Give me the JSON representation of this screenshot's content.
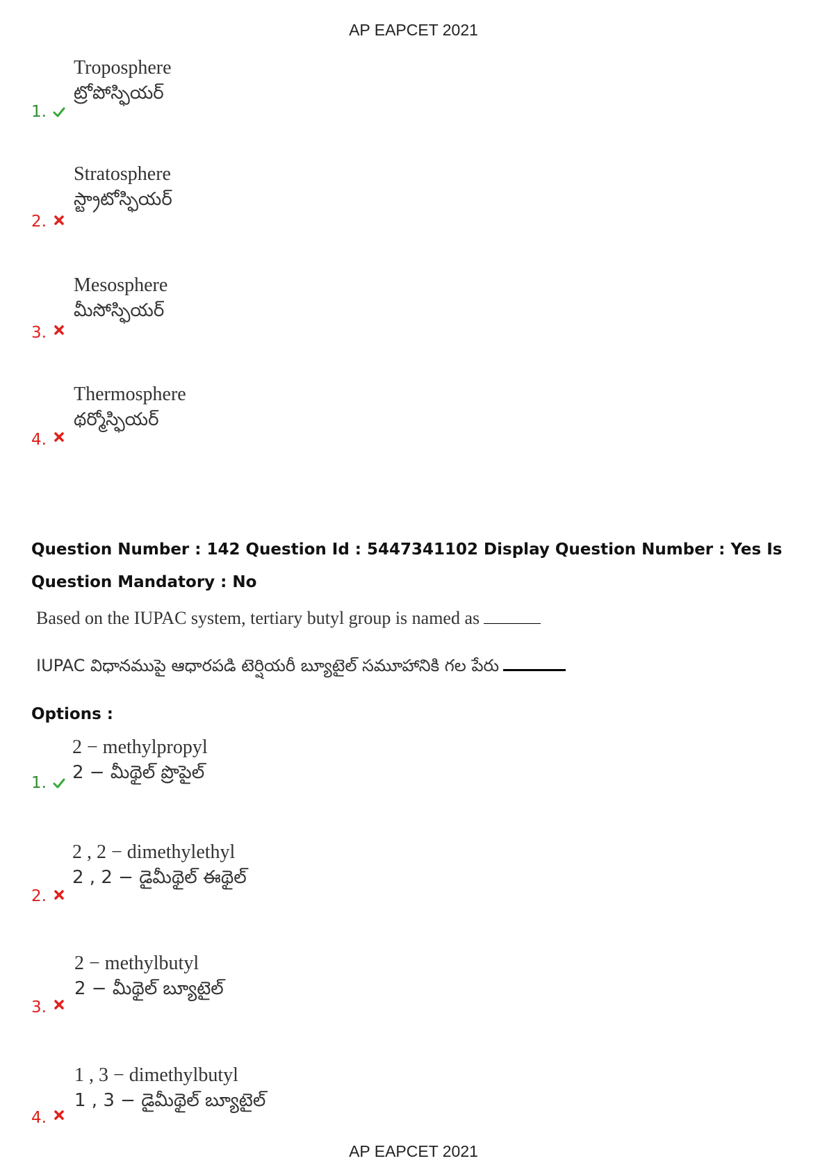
{
  "header": {
    "title": "AP EAPCET 2021"
  },
  "footer": {
    "title": "AP EAPCET 2021"
  },
  "prev_options": [
    {
      "number": "1.",
      "status": "correct",
      "en": "Troposphere",
      "te": "ట్రోపోస్ఫియర్"
    },
    {
      "number": "2.",
      "status": "wrong",
      "en": "Stratosphere",
      "te": "స్ట్రాటోస్ఫియర్"
    },
    {
      "number": "3.",
      "status": "wrong",
      "en": "Mesosphere",
      "te": "మీసోస్ఫియర్"
    },
    {
      "number": "4.",
      "status": "wrong",
      "en": "Thermosphere",
      "te": "థర్మోస్ఫియర్"
    }
  ],
  "question": {
    "meta": "Question Number : 142 Question Id : 5447341102 Display Question Number : Yes Is Question Mandatory : No",
    "text_en": "Based on the IUPAC system, tertiary butyl group is named as",
    "text_te": "IUPAC విధానముపై ఆధారపడి టెర్షియరీ బ్యూటైల్ సమూహానికి గల పేరు",
    "options_label": "Options :",
    "options": [
      {
        "number": "1.",
        "status": "correct",
        "en": "2 − methylpropyl",
        "te": "2 − మీథైల్ ప్రొపైల్"
      },
      {
        "number": "2.",
        "status": "wrong",
        "en": "2 , 2 − dimethylethyl",
        "te": "2 , 2 − డైమీథైల్ ఈథైల్"
      },
      {
        "number": "3.",
        "status": "wrong",
        "en": "2 − methylbutyl",
        "te": "2 − మీథైల్ బ్యూటైల్"
      },
      {
        "number": "4.",
        "status": "wrong",
        "en": "1 , 3 − dimethylbutyl",
        "te": "1 , 3 − డైమీథైల్ బ్యూటైల్"
      }
    ]
  },
  "icons": {
    "correct": "check-icon",
    "wrong": "cross-icon"
  },
  "colors": {
    "correct": "#2e8b2e",
    "wrong": "#e0201c"
  }
}
